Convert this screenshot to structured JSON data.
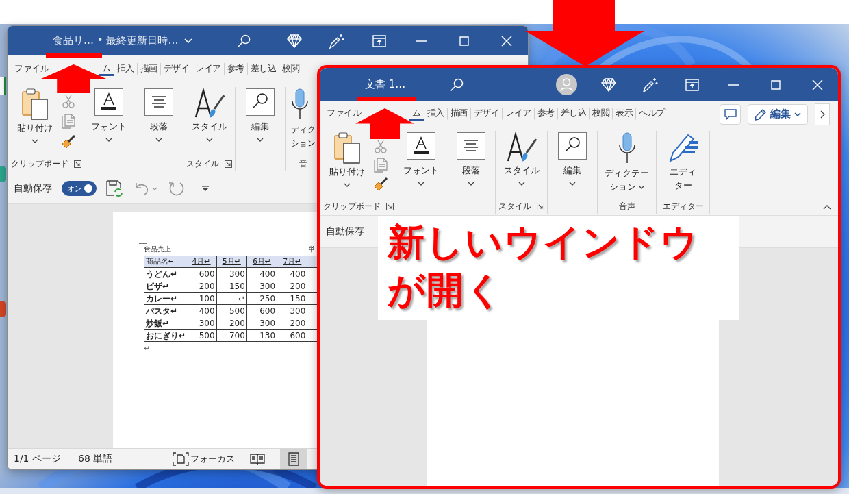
{
  "windows": [
    {
      "title": "食品リ… • 最終更新日時…",
      "title_menu": true,
      "account": false,
      "highlighted": false,
      "marked": true,
      "tabs": [
        {
          "label": "ファイル",
          "selected": false
        },
        {
          "label": "ム",
          "selected": true
        },
        {
          "label": "挿入",
          "selected": false
        },
        {
          "label": "描画",
          "selected": false
        },
        {
          "label": "デザイ",
          "selected": false
        },
        {
          "label": "レイア",
          "selected": false
        },
        {
          "label": "参考",
          "selected": false
        },
        {
          "label": "差し込",
          "selected": false
        },
        {
          "label": "校閲",
          "selected": false
        }
      ],
      "ribbon": [
        {
          "kind": "clipboard",
          "lines": [
            "貼り付け"
          ],
          "dropdown": true,
          "label": "クリップボード",
          "launcher": true
        },
        {
          "kind": "font",
          "lines": [
            "フォント"
          ],
          "dropdown": true
        },
        {
          "kind": "paragraph",
          "lines": [
            "段落"
          ],
          "dropdown": true
        },
        {
          "kind": "styles",
          "lines": [
            "スタイル"
          ],
          "dropdown": true,
          "label": "スタイル",
          "launcher": true
        },
        {
          "kind": "editing",
          "lines": [
            "編集"
          ],
          "dropdown": true
        },
        {
          "kind": "dictation",
          "lines": [
            "ディク",
            "ション"
          ],
          "dropdown": false,
          "label": "音"
        }
      ],
      "quick_access": {
        "autosave_label": "自動保存",
        "toggle": {
          "label": "オン",
          "on": true
        },
        "commands": true
      },
      "document": {
        "heading": "食品売上",
        "heading_right": "単",
        "table": {
          "columns": [
            "商品名↵",
            "4月↵",
            "5月↵",
            "6月↵",
            "7月↵"
          ],
          "rows": [
            [
              "うどん↵",
              "600",
              "300",
              "400",
              "400"
            ],
            [
              "ピザ↵",
              "200",
              "150",
              "300",
              "200"
            ],
            [
              "カレー↵",
              "100",
              "↵",
              "250",
              "150"
            ],
            [
              "パスタ↵",
              "400",
              "500",
              "600",
              "300"
            ],
            [
              "炒飯↵",
              "300",
              "200",
              "300",
              "200"
            ],
            [
              "おにぎり↵",
              "500",
              "700",
              "130",
              "600"
            ]
          ]
        },
        "after": "↵"
      },
      "status_bar": {
        "page": "1/1 ページ",
        "words": "68 単語",
        "focus": "フォーカス",
        "views": [
          {
            "kind": "read",
            "selected": false
          },
          {
            "kind": "print",
            "selected": true
          }
        ]
      }
    },
    {
      "title": "文書 1…",
      "title_menu": false,
      "account": true,
      "highlighted": true,
      "marked": true,
      "tabs": [
        {
          "label": "ファイル",
          "selected": false
        },
        {
          "label": "ム",
          "selected": true
        },
        {
          "label": "挿入",
          "selected": false
        },
        {
          "label": "描画",
          "selected": false
        },
        {
          "label": "デザイ",
          "selected": false
        },
        {
          "label": "レイア",
          "selected": false
        },
        {
          "label": "参考",
          "selected": false
        },
        {
          "label": "差し込",
          "selected": false
        },
        {
          "label": "校閲",
          "selected": false
        },
        {
          "label": "表示",
          "selected": false
        },
        {
          "label": "ヘルプ",
          "selected": false
        }
      ],
      "tab_actions": {
        "comments": true,
        "mode": "編集",
        "more": true
      },
      "ribbon": [
        {
          "kind": "clipboard",
          "lines": [
            "貼り付け"
          ],
          "dropdown": true,
          "label": "クリップボード",
          "launcher": true
        },
        {
          "kind": "font",
          "lines": [
            "フォント"
          ],
          "dropdown": true
        },
        {
          "kind": "paragraph",
          "lines": [
            "段落"
          ],
          "dropdown": true
        },
        {
          "kind": "styles",
          "lines": [
            "スタイル"
          ],
          "dropdown": true,
          "label": "スタイル",
          "launcher": true
        },
        {
          "kind": "editing",
          "lines": [
            "編集"
          ],
          "dropdown": true
        },
        {
          "kind": "dictation",
          "lines": [
            "ディクテー",
            "ション"
          ],
          "dropdown": true,
          "label": "音声"
        },
        {
          "kind": "editor",
          "lines": [
            "エディ",
            "ター"
          ],
          "dropdown": false,
          "label": "エディター"
        }
      ],
      "ribbon_collapse": true,
      "quick_access": {
        "autosave_label": "自動保存"
      }
    }
  ],
  "annotations": {
    "callout": "新しいウインドウが開く"
  }
}
